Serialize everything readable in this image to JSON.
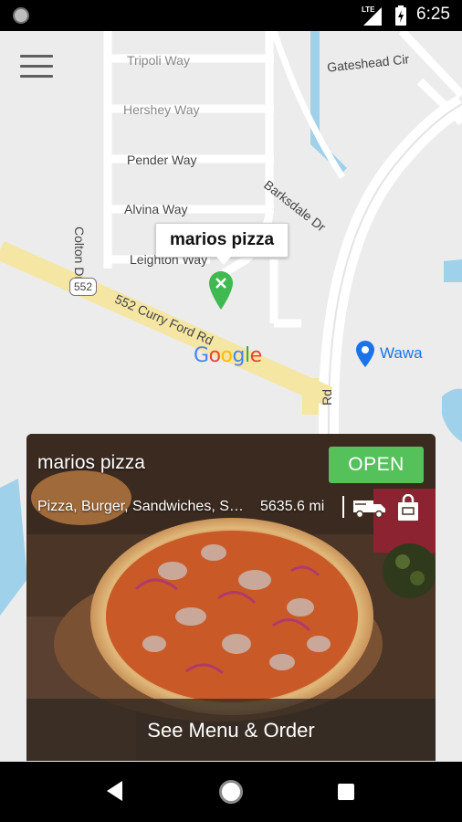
{
  "status_bar": {
    "time": "6:25",
    "network": "LTE",
    "icons": [
      "notification-dot-icon",
      "signal-icon",
      "battery-icon"
    ]
  },
  "map": {
    "menu_icon": "hamburger-menu-icon",
    "streets": {
      "tripoli": "Tripoli Way",
      "hershey": "Hershey Way",
      "pender": "Pender Way",
      "alvina": "Alvina Way",
      "leighton": "Leighton Way",
      "gateshead": "Gateshead Cir",
      "barksdale": "Barksdale Dr",
      "colton": "Colton Dr",
      "curry_ford": "552 Curry Ford Rd",
      "side_road": "Rd"
    },
    "route_badge": "552",
    "marker_label": "marios pizza",
    "poi_label": "Wawa",
    "logo_text": [
      "G",
      "o",
      "o",
      "g",
      "l",
      "e"
    ],
    "colors": {
      "background": "#ececec",
      "road": "#ffffff",
      "highway": "#f5e6a3",
      "water": "#9fd1ea",
      "marker": "#3fb950",
      "poi": "#1a73e8"
    }
  },
  "restaurant_card": {
    "name": "marios pizza",
    "status": "OPEN",
    "cuisine": "Pizza, Burger, Sandwiches, Salads",
    "distance": "5635.6 mi",
    "icons": [
      "delivery-truck-icon",
      "shopping-bag-icon"
    ],
    "action_label": "See Menu & Order",
    "colors": {
      "open_badge": "#55c15a"
    }
  },
  "nav_bar": {
    "icons": [
      "back-icon",
      "home-icon",
      "recent-apps-icon"
    ]
  }
}
